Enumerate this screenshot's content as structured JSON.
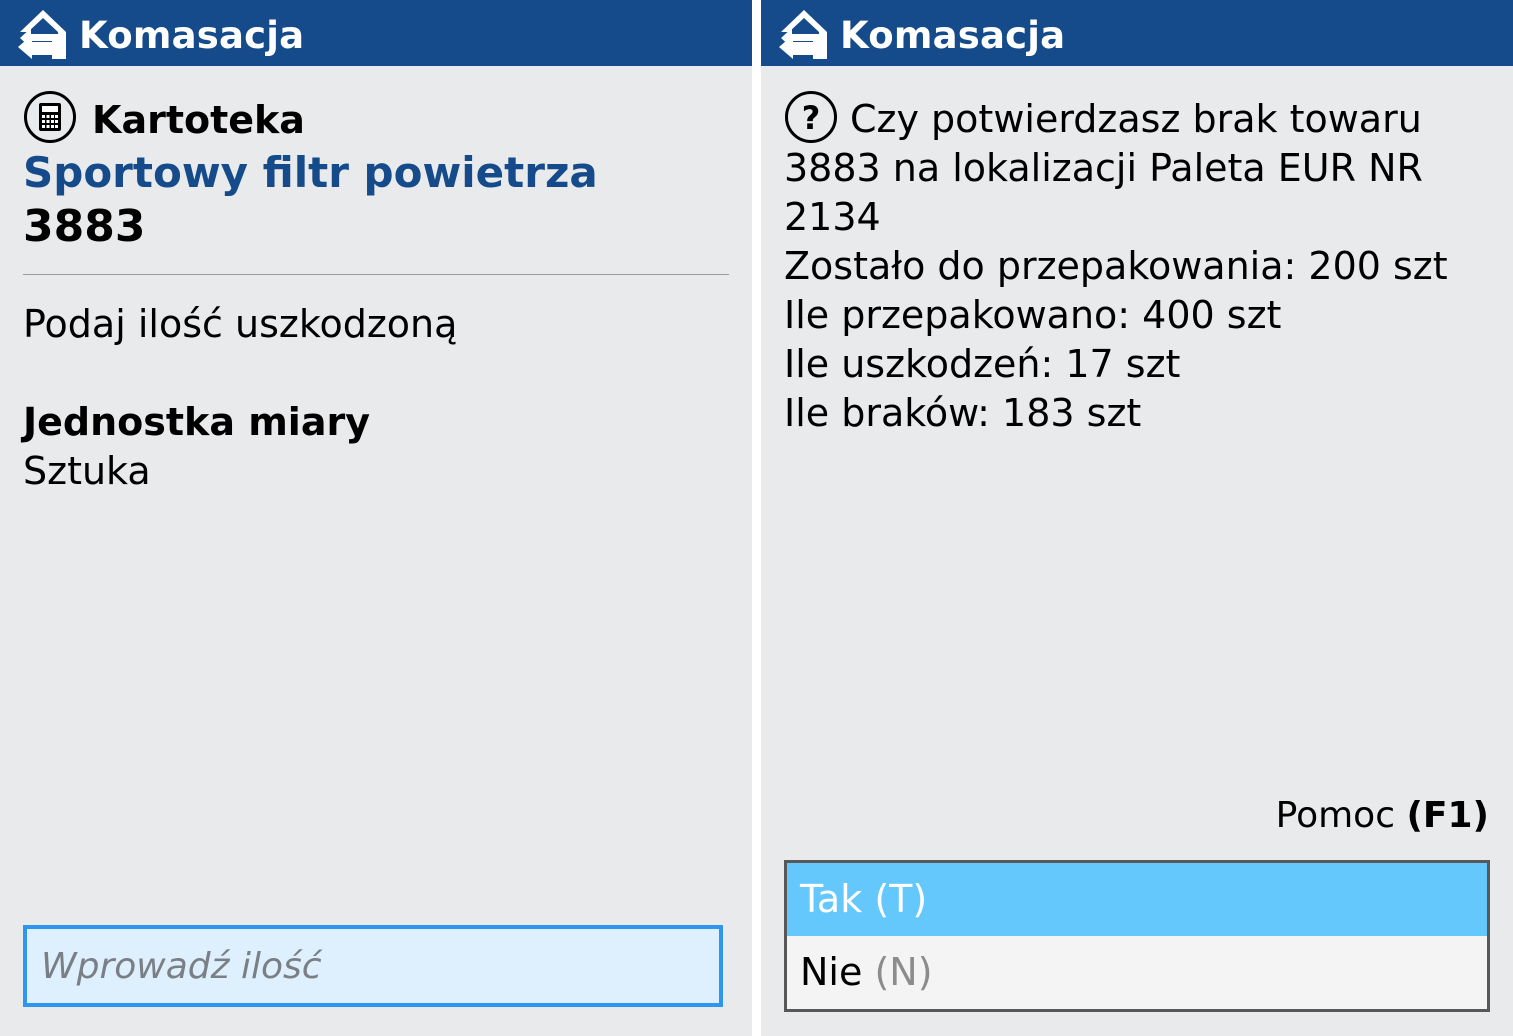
{
  "left": {
    "header": {
      "title": "Komasacja",
      "icon": "back-arrow-icon"
    },
    "card_label": "Kartoteka",
    "card_icon": "calculator-icon",
    "product_name": "Sportowy filtr powietrza",
    "product_code": "3883",
    "prompt": "Podaj ilość uszkodzoną",
    "unit_label": "Jednostka miary",
    "unit_value": "Sztuka",
    "quantity_input": {
      "placeholder": "Wprowadź ilość",
      "value": ""
    }
  },
  "right": {
    "header": {
      "title": "Komasacja",
      "icon": "back-arrow-icon"
    },
    "question_icon": "question-mark-icon",
    "message_lines": [
      "Czy potwierdzasz brak towaru",
      "3883 na lokalizacji Paleta EUR NR",
      "2134",
      "Zostało do przepakowania: 200 szt",
      "Ile przepakowano: 400 szt",
      "Ile uszkodzeń: 17 szt",
      "Ile braków: 183 szt"
    ],
    "help": {
      "label": "Pomoc",
      "key": "(F1)"
    },
    "options": [
      {
        "label": "Tak",
        "key": "(T)",
        "selected": true
      },
      {
        "label": "Nie",
        "key": "(N)",
        "selected": false
      }
    ]
  },
  "colors": {
    "header_bg": "#154b8a",
    "screen_bg": "#e9eaec",
    "product_name": "#154b8a",
    "input_border": "#2f96f0",
    "input_bg": "#def0fd",
    "option_selected_bg": "#64c8fc"
  }
}
